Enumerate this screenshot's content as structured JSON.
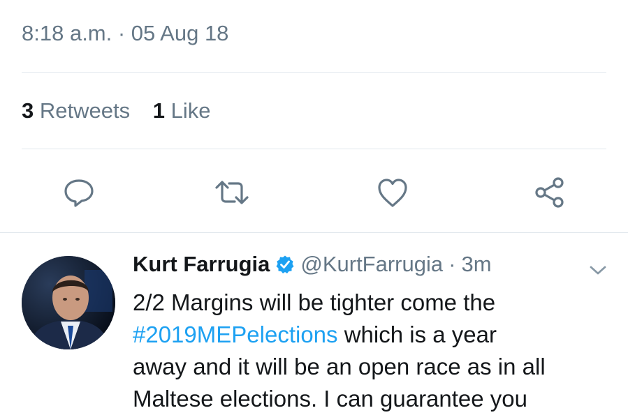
{
  "tweet": {
    "timestamp": "8:18 a.m. · 05 Aug 18",
    "retweets_count": "3",
    "retweets_label": "Retweets",
    "likes_count": "1",
    "likes_label": "Like"
  },
  "actions": [
    {
      "icon": "reply-icon"
    },
    {
      "icon": "retweet-icon"
    },
    {
      "icon": "like-icon"
    },
    {
      "icon": "share-icon"
    }
  ],
  "reply": {
    "author_name": "Kurt Farrugia",
    "handle": "@KurtFarrugia",
    "separator": "·",
    "age": "3m",
    "text_line1": "2/2 Margins will be tighter come the",
    "hashtag": "#2019MEPelections",
    "text_line2_rest": " which is a year",
    "text_line3": "away and it will be an open race as in all",
    "text_line4": "Maltese elections. I can guarantee you"
  },
  "colors": {
    "accent": "#1da1f2",
    "secondary_text": "#657786",
    "divider": "#e1e8ed",
    "icon": "#657786"
  }
}
